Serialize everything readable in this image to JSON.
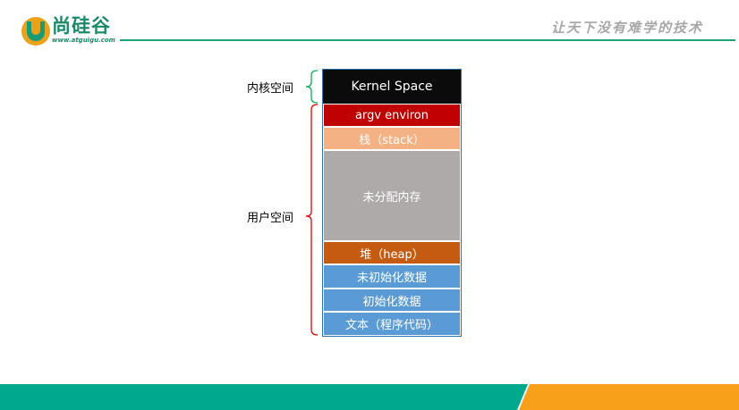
{
  "header": {
    "logo_name": "尚硅谷",
    "logo_url": "www.atguigu.com",
    "slogan": "让天下没有难学的技术"
  },
  "diagram": {
    "kernel_label": "内核空间",
    "user_label": "用户空间",
    "segments": [
      {
        "id": "kernel",
        "label": "Kernel Space",
        "color": "#0b0b0b"
      },
      {
        "id": "argv",
        "label": "argv environ",
        "color": "#c00000"
      },
      {
        "id": "stack",
        "label": "栈（stack）",
        "color": "#f4b183"
      },
      {
        "id": "free",
        "label": "未分配内存",
        "color": "#aeaaaa"
      },
      {
        "id": "heap",
        "label": "堆（heap）",
        "color": "#c55a11"
      },
      {
        "id": "bss",
        "label": "未初始化数据",
        "color": "#5b9bd5"
      },
      {
        "id": "data",
        "label": "初始化数据",
        "color": "#5b9bd5"
      },
      {
        "id": "text",
        "label": "文本（程序代码）",
        "color": "#5b9bd5"
      }
    ],
    "brace_colors": {
      "kernel": "#00b050",
      "user": "#e00000"
    }
  },
  "footer": {
    "left_color": "#00a98e",
    "right_color": "#f9a01b"
  }
}
